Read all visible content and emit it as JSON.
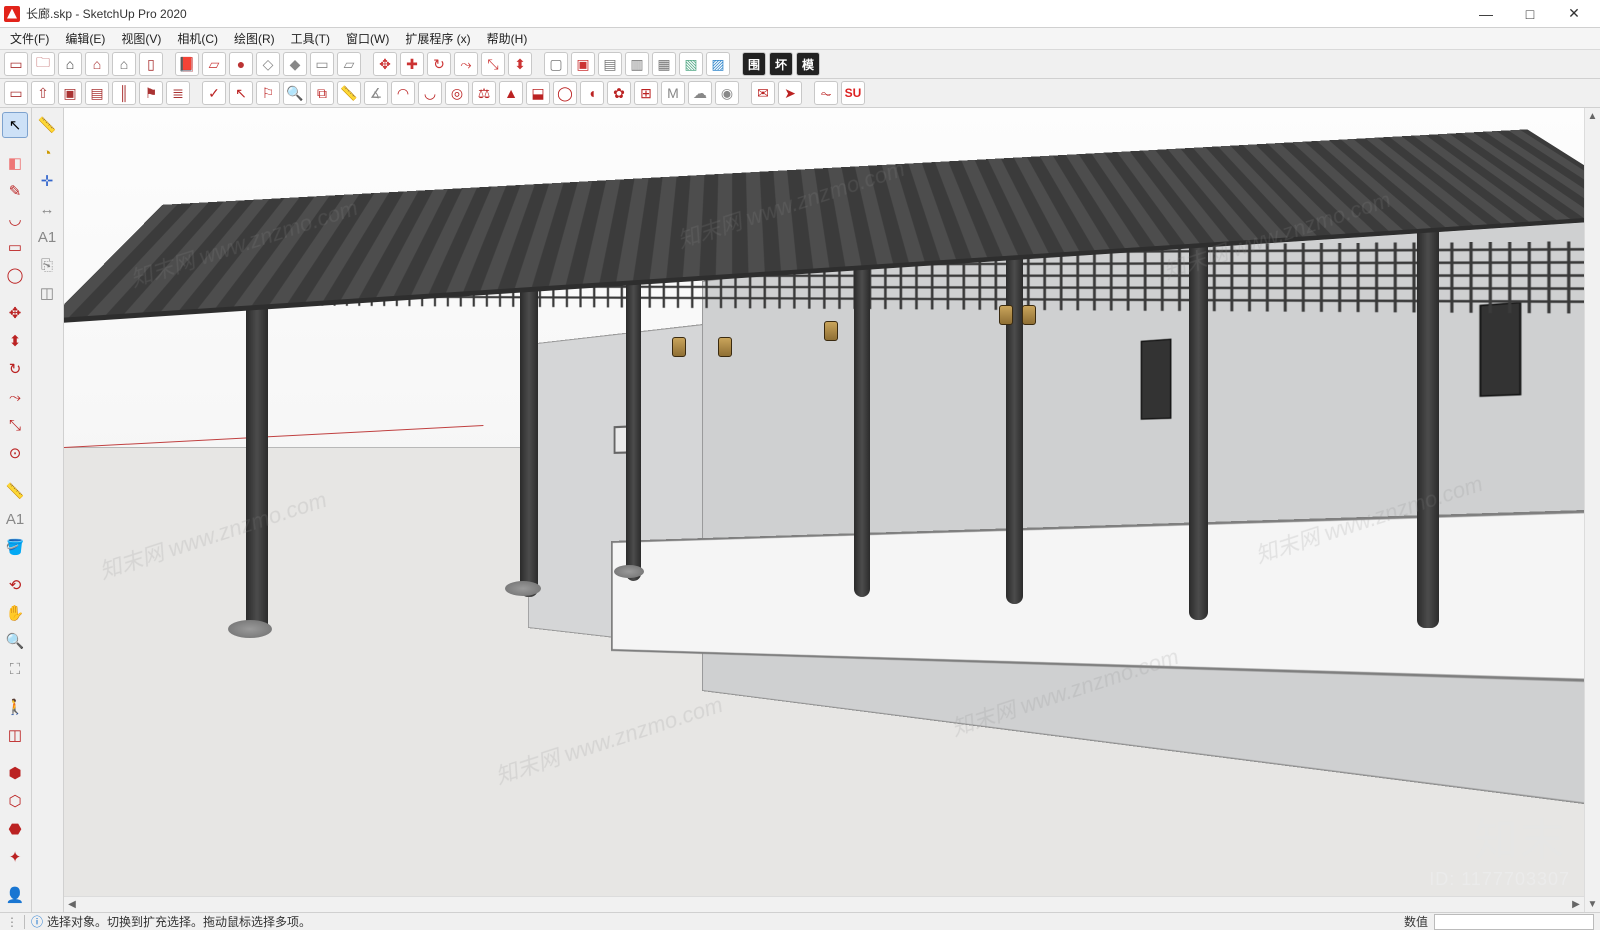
{
  "title": "长廊.skp - SketchUp Pro 2020",
  "window_controls": {
    "min": "—",
    "max": "□",
    "close": "✕"
  },
  "menus": [
    {
      "label": "文件(F)"
    },
    {
      "label": "编辑(E)"
    },
    {
      "label": "视图(V)"
    },
    {
      "label": "相机(C)"
    },
    {
      "label": "绘图(R)"
    },
    {
      "label": "工具(T)"
    },
    {
      "label": "窗口(W)"
    },
    {
      "label": "扩展程序 (x)"
    },
    {
      "label": "帮助(H)"
    }
  ],
  "toolbar_row1": [
    {
      "name": "new-file-icon",
      "glyph": "▭",
      "color": "#a33"
    },
    {
      "name": "open-file-icon",
      "glyph": "🗀",
      "color": "#a33"
    },
    {
      "name": "house-solid-icon",
      "glyph": "⌂",
      "color": "#444"
    },
    {
      "name": "house-outline-icon",
      "glyph": "⌂",
      "color": "#a33"
    },
    {
      "name": "house-line-icon",
      "glyph": "⌂",
      "color": "#666"
    },
    {
      "name": "door-icon",
      "glyph": "▯",
      "color": "#a33"
    },
    {
      "name": "sep"
    },
    {
      "name": "book-icon",
      "glyph": "📕",
      "color": "#a33"
    },
    {
      "name": "sheet-icon",
      "glyph": "▱",
      "color": "#c44"
    },
    {
      "name": "ball-icon",
      "glyph": "●",
      "color": "#b33"
    },
    {
      "name": "wire-icon",
      "glyph": "◇",
      "color": "#888"
    },
    {
      "name": "shaded-icon",
      "glyph": "◆",
      "color": "#888"
    },
    {
      "name": "style1-icon",
      "glyph": "▭",
      "color": "#888"
    },
    {
      "name": "style2-icon",
      "glyph": "▱",
      "color": "#888"
    },
    {
      "name": "sep"
    },
    {
      "name": "arrows-icon",
      "glyph": "✥",
      "color": "#c33"
    },
    {
      "name": "move-icon",
      "glyph": "✚",
      "color": "#c33"
    },
    {
      "name": "rotate-icon",
      "glyph": "↻",
      "color": "#c33"
    },
    {
      "name": "follow-icon",
      "glyph": "⤳",
      "color": "#c33"
    },
    {
      "name": "scale-icon",
      "glyph": "⤡",
      "color": "#c33"
    },
    {
      "name": "pushpull-icon",
      "glyph": "⬍",
      "color": "#c33"
    },
    {
      "name": "sep"
    },
    {
      "name": "box1-icon",
      "glyph": "▢",
      "color": "#777"
    },
    {
      "name": "box2-icon",
      "glyph": "▣",
      "color": "#c33"
    },
    {
      "name": "box3-icon",
      "glyph": "▤",
      "color": "#777"
    },
    {
      "name": "box4-icon",
      "glyph": "▥",
      "color": "#777"
    },
    {
      "name": "box5-icon",
      "glyph": "▦",
      "color": "#777"
    },
    {
      "name": "box6-icon",
      "glyph": "▧",
      "color": "#5a8"
    },
    {
      "name": "box7-icon",
      "glyph": "▨",
      "color": "#38c"
    },
    {
      "name": "sep"
    },
    {
      "name": "label-wei",
      "text": "围",
      "bg": "#222",
      "fg": "#fff"
    },
    {
      "name": "label-huai",
      "text": "坏",
      "bg": "#222",
      "fg": "#fff"
    },
    {
      "name": "label-mo",
      "text": "模",
      "bg": "#222",
      "fg": "#fff"
    }
  ],
  "toolbar_row2": [
    {
      "name": "undo-icon",
      "glyph": "▭",
      "color": "#a33"
    },
    {
      "name": "redo-icon",
      "glyph": "⇧",
      "color": "#a33"
    },
    {
      "name": "frame-icon",
      "glyph": "▣",
      "color": "#a33"
    },
    {
      "name": "frame2-icon",
      "glyph": "▤",
      "color": "#a33"
    },
    {
      "name": "columns-icon",
      "glyph": "║",
      "color": "#a33"
    },
    {
      "name": "tag-icon",
      "glyph": "⚑",
      "color": "#a33"
    },
    {
      "name": "layers-icon",
      "glyph": "≣",
      "color": "#a33"
    },
    {
      "name": "sep"
    },
    {
      "name": "check-icon",
      "glyph": "✓",
      "color": "#b22"
    },
    {
      "name": "pointer-icon",
      "glyph": "↖",
      "color": "#b22"
    },
    {
      "name": "flag-icon",
      "glyph": "⚐",
      "color": "#b22"
    },
    {
      "name": "zoom-icon",
      "glyph": "🔍",
      "color": "#b22"
    },
    {
      "name": "copy-icon",
      "glyph": "⧉",
      "color": "#b22"
    },
    {
      "name": "tape-icon",
      "glyph": "📏",
      "color": "#888"
    },
    {
      "name": "angle-icon",
      "glyph": "∡",
      "color": "#888"
    },
    {
      "name": "arc-icon",
      "glyph": "◠",
      "color": "#b22"
    },
    {
      "name": "arc2-icon",
      "glyph": "◡",
      "color": "#b22"
    },
    {
      "name": "target-icon",
      "glyph": "◎",
      "color": "#b22"
    },
    {
      "name": "weight-icon",
      "glyph": "⚖",
      "color": "#b22"
    },
    {
      "name": "paint2-icon",
      "glyph": "▲",
      "color": "#b22"
    },
    {
      "name": "stamp-icon",
      "glyph": "⬓",
      "color": "#b22"
    },
    {
      "name": "circle-tool-icon",
      "glyph": "◯",
      "color": "#b22"
    },
    {
      "name": "rainbow-icon",
      "glyph": "◖",
      "color": "#b22"
    },
    {
      "name": "gear2-icon",
      "glyph": "✿",
      "color": "#b22"
    },
    {
      "name": "grid-icon",
      "glyph": "⊞",
      "color": "#b22"
    },
    {
      "name": "m-icon",
      "glyph": "M",
      "color": "#888"
    },
    {
      "name": "cloud-icon",
      "glyph": "☁",
      "color": "#888"
    },
    {
      "name": "target2-icon",
      "glyph": "◉",
      "color": "#888"
    },
    {
      "name": "sep"
    },
    {
      "name": "mail-icon",
      "glyph": "✉",
      "color": "#b22"
    },
    {
      "name": "send-icon",
      "glyph": "➤",
      "color": "#b22"
    },
    {
      "name": "sep"
    },
    {
      "name": "wifi-icon",
      "glyph": "⏦",
      "color": "#b22"
    },
    {
      "name": "su-label",
      "text": "SU",
      "bg": "#fff",
      "fg": "#d22"
    }
  ],
  "left_toolbar": [
    {
      "name": "select-tool-icon",
      "glyph": "↖",
      "sel": true
    },
    {
      "name": "spacer"
    },
    {
      "name": "eraser-tool-icon",
      "glyph": "◧",
      "color": "#e77"
    },
    {
      "name": "line-tool-icon",
      "glyph": "✎",
      "color": "#b22"
    },
    {
      "name": "arc-tool-icon",
      "glyph": "◡",
      "color": "#b22"
    },
    {
      "name": "shape-tool-icon",
      "glyph": "▭",
      "color": "#b22"
    },
    {
      "name": "circle-left-icon",
      "glyph": "◯",
      "color": "#b22"
    },
    {
      "name": "spacer"
    },
    {
      "name": "move-left-icon",
      "glyph": "✥",
      "color": "#b22"
    },
    {
      "name": "pushpull-left-icon",
      "glyph": "⬍",
      "color": "#b22"
    },
    {
      "name": "rotate-left-icon",
      "glyph": "↻",
      "color": "#b22"
    },
    {
      "name": "followme-icon",
      "glyph": "⤳",
      "color": "#b22"
    },
    {
      "name": "scale-left-icon",
      "glyph": "⤡",
      "color": "#b22"
    },
    {
      "name": "offset-icon",
      "glyph": "⊙",
      "color": "#b22"
    },
    {
      "name": "spacer"
    },
    {
      "name": "tape-left-icon",
      "glyph": "📏",
      "color": "#888"
    },
    {
      "name": "text-tool-icon",
      "glyph": "A1",
      "color": "#888"
    },
    {
      "name": "paint-left-icon",
      "glyph": "🪣",
      "color": "#c80"
    },
    {
      "name": "spacer"
    },
    {
      "name": "orbit-icon",
      "glyph": "⟲",
      "color": "#b22"
    },
    {
      "name": "pan-icon",
      "glyph": "✋",
      "color": "#c80"
    },
    {
      "name": "zoom-left-icon",
      "glyph": "🔍",
      "color": "#888"
    },
    {
      "name": "zoomext-icon",
      "glyph": "⛶",
      "color": "#888"
    },
    {
      "name": "spacer"
    },
    {
      "name": "walk-icon",
      "glyph": "🚶",
      "color": "#b22"
    },
    {
      "name": "section-left-icon",
      "glyph": "◫",
      "color": "#b22"
    },
    {
      "name": "spacer"
    },
    {
      "name": "component-icon",
      "glyph": "⬢",
      "color": "#b22"
    },
    {
      "name": "3dw-icon",
      "glyph": "⬡",
      "color": "#b22"
    },
    {
      "name": "warehouse-icon",
      "glyph": "⬣",
      "color": "#b22"
    },
    {
      "name": "ext-icon",
      "glyph": "✦",
      "color": "#b22"
    },
    {
      "name": "spacer"
    },
    {
      "name": "user-icon",
      "glyph": "👤",
      "color": "#666"
    }
  ],
  "left_toolbar2": [
    {
      "name": "tape2-icon",
      "glyph": "📏",
      "color": "#c90"
    },
    {
      "name": "protractor-icon",
      "glyph": "◔",
      "color": "#c90"
    },
    {
      "name": "axes-icon",
      "glyph": "✛",
      "color": "#36c"
    },
    {
      "name": "dimension-icon",
      "glyph": "↔",
      "color": "#888"
    },
    {
      "name": "text2-icon",
      "glyph": "A1",
      "color": "#888"
    },
    {
      "name": "label-icon",
      "glyph": "⎘",
      "color": "#888"
    },
    {
      "name": "section2-icon",
      "glyph": "◫",
      "color": "#888"
    }
  ],
  "status": {
    "hint": "选择对象。切换到扩充选择。拖动鼠标选择多项。",
    "value_label": "数值"
  },
  "watermarks": {
    "text": "知末网 www.znzmo.com",
    "brand": "知末",
    "id": "ID: 1177703307"
  }
}
